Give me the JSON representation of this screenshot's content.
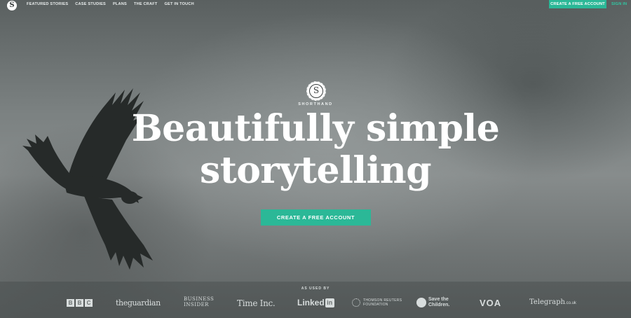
{
  "nav": {
    "brand_letter": "S",
    "links": [
      "FEATURED STORIES",
      "CASE STUDIES",
      "PLANS",
      "THE CRAFT",
      "GET IN TOUCH"
    ],
    "cta": "CREATE A FREE ACCOUNT",
    "signin": "SIGN IN"
  },
  "hero": {
    "logo_letter": "S",
    "logo_word": "SHORTHAND",
    "headline_line1": "Beautifully simple",
    "headline_line2": "storytelling",
    "cta": "CREATE A FREE ACCOUNT"
  },
  "clients": {
    "label": "AS USED BY",
    "bbc": [
      "B",
      "B",
      "C"
    ],
    "guardian": "theguardian",
    "business_insider_l1": "BUSINESS",
    "business_insider_l2": "INSIDER",
    "timeinc": "Time Inc.",
    "linkedin_word": "Linked",
    "linkedin_in": "in",
    "thomson_l1": "THOMSON REUTERS",
    "thomson_l2": "FOUNDATION",
    "save_l1": "Save the",
    "save_l2": "Children.",
    "voa": "VOA",
    "telegraph": "Telegraph",
    "telegraph_suffix": ".co.uk"
  },
  "colors": {
    "accent": "#2bb897",
    "signin": "#2fc8a3",
    "sky": "#7b8181"
  }
}
